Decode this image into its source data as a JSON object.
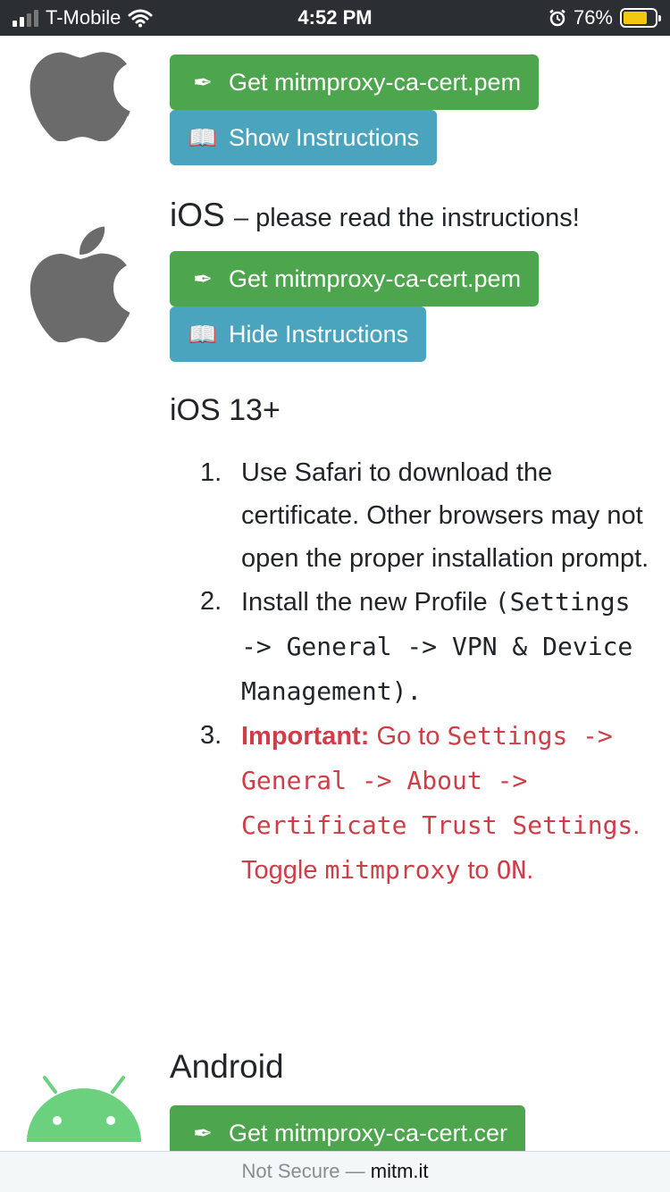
{
  "status": {
    "carrier": "T-Mobile",
    "time": "4:52 PM",
    "battery": "76%",
    "battery_level": 0.76
  },
  "sections": [
    {
      "get_label": "Get mitmproxy-ca-cert.pem",
      "toggle_label": "Show Instructions"
    },
    {
      "title": "iOS",
      "subtitle": "– please read the instructions!",
      "get_label": "Get mitmproxy-ca-cert.pem",
      "toggle_label": "Hide Instructions",
      "instructions_title": "iOS 13+",
      "steps": [
        {
          "num": "1.",
          "text": "Use Safari to download the certificate. Other browsers may not open the proper installation prompt."
        },
        {
          "num": "2.",
          "text_before": "Install the new Profile",
          "code": "(Settings -> General -> VPN & Device Management).",
          "text_after": "."
        },
        {
          "num": "3.",
          "strong": "Important:",
          "text_a": "Go to",
          "code_a": "Settings -> General -> About -> Certificate Trust Settings",
          "text_b": ". Toggle",
          "code_b": "mitmproxy",
          "text_c": "to",
          "code_c": "ON",
          "text_d": "."
        }
      ]
    },
    {
      "title": "Android",
      "get_label": "Get mitmproxy-ca-cert.cer"
    }
  ],
  "urlbar": {
    "security": "Not Secure —",
    "host": "mitm.it"
  },
  "colors": {
    "green": "#4da64d",
    "blue": "#4aa4bd",
    "important": "#cf3e47",
    "apple_logo": "#6b6b6b",
    "android_logo": "#6cd17f"
  },
  "icons": {
    "download": "pen-nib-icon",
    "instructions": "book-icon"
  }
}
